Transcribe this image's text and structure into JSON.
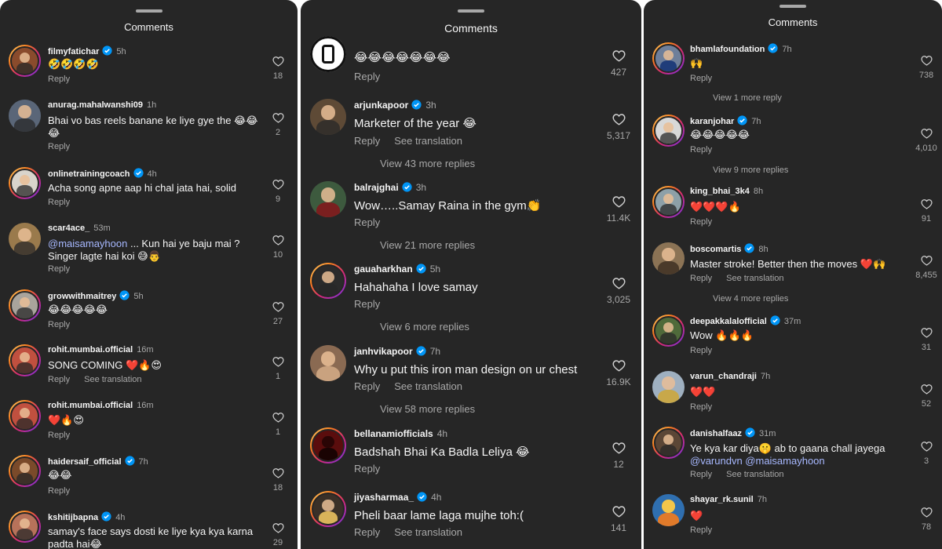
{
  "panels": [
    {
      "title": "Comments",
      "comments": [
        {
          "username": "filmyfatichar",
          "verified": true,
          "time": "5h",
          "text": "🤣🤣🤣🤣",
          "reply": "Reply",
          "likes": "18"
        },
        {
          "username": "anurag.mahalwanshi09",
          "verified": false,
          "time": "1h",
          "text": "Bhai vo bas reels banane ke liye gye the 😂😂😂",
          "reply": "Reply",
          "likes": "2"
        },
        {
          "username": "onlinetrainingcoach",
          "verified": true,
          "time": "4h",
          "text": "Acha song apne aap hi chal jata hai, solid",
          "reply": "Reply",
          "likes": "9"
        },
        {
          "username": "scar4ace_",
          "verified": false,
          "time": "53m",
          "mention": "@maisamayhoon",
          "text": " ... Kun hai ye baju mai ? Singer lagte hai koi 😅👨",
          "reply": "Reply",
          "likes": "10"
        },
        {
          "username": "growwithmaitrey",
          "verified": true,
          "time": "5h",
          "text": "😂😂😂😂😂",
          "reply": "Reply",
          "likes": "27"
        },
        {
          "username": "rohit.mumbai.official",
          "verified": false,
          "time": "16m",
          "text": "SONG COMING ❤️🔥😍",
          "reply": "Reply",
          "translate": "See translation",
          "likes": "1"
        },
        {
          "username": "rohit.mumbai.official",
          "verified": false,
          "time": "16m",
          "text": "❤️🔥😍",
          "reply": "Reply",
          "likes": "1"
        },
        {
          "username": "haidersaif_official",
          "verified": true,
          "time": "7h",
          "text": "😂😂",
          "reply": "Reply",
          "likes": "18"
        },
        {
          "username": "kshitijbapna",
          "verified": true,
          "time": "4h",
          "text": "samay's face says dosti ke liye kya kya karna padta hai😂",
          "reply": "",
          "likes": "29"
        }
      ]
    },
    {
      "title": "Comments",
      "comments": [
        {
          "username": "",
          "verified": false,
          "time": "",
          "text": "😂😂😂😂😂😂😂",
          "reply": "Reply",
          "likes": "427"
        },
        {
          "username": "arjunkapoor",
          "verified": true,
          "time": "3h",
          "text": "Marketer of the year 😂",
          "reply": "Reply",
          "translate": "See translation",
          "likes": "5,317",
          "more": "View 43 more replies"
        },
        {
          "username": "balrajghai",
          "verified": true,
          "time": "3h",
          "text": "Wow…..Samay Raina in the gym👏",
          "reply": "Reply",
          "likes": "11.4K",
          "more": "View 21 more replies"
        },
        {
          "username": "gauaharkhan",
          "verified": true,
          "time": "5h",
          "text": "Hahahaha I love samay",
          "reply": "Reply",
          "likes": "3,025",
          "more": "View 6 more replies"
        },
        {
          "username": "janhvikapoor",
          "verified": true,
          "time": "7h",
          "text": "Why u put this iron man design on ur chest",
          "reply": "Reply",
          "translate": "See translation",
          "likes": "16.9K",
          "more": "View 58 more replies"
        },
        {
          "username": "bellanamiofficials",
          "verified": false,
          "time": "4h",
          "text": "Badshah Bhai Ka Badla Leliya 😂",
          "reply": "Reply",
          "likes": "12"
        },
        {
          "username": "jiyasharmaa_",
          "verified": true,
          "time": "4h",
          "text": "Pheli baar lame laga mujhe toh:(",
          "reply": "Reply",
          "translate": "See translation",
          "likes": "141"
        }
      ]
    },
    {
      "title": "Comments",
      "comments": [
        {
          "username": "bhamlafoundation",
          "verified": true,
          "time": "7h",
          "text": "🙌",
          "reply": "Reply",
          "likes": "738",
          "more": "View 1 more reply"
        },
        {
          "username": "karanjohar",
          "verified": true,
          "time": "7h",
          "text": "😂😂😂😂😂",
          "reply": "Reply",
          "likes": "4,010",
          "more": "View 9 more replies"
        },
        {
          "username": "king_bhai_3k4",
          "verified": false,
          "time": "8h",
          "text": "❤️❤️❤️🔥",
          "reply": "Reply",
          "likes": "91"
        },
        {
          "username": "boscomartis",
          "verified": true,
          "time": "8h",
          "text": "Master stroke! Better then the moves ❤️🙌",
          "reply": "Reply",
          "translate": "See translation",
          "likes": "8,455",
          "more": "View 4 more replies"
        },
        {
          "username": "deepakkalalofficial",
          "verified": true,
          "time": "37m",
          "text": "Wow 🔥🔥🔥",
          "reply": "Reply",
          "likes": "31"
        },
        {
          "username": "varun_chandraji",
          "verified": false,
          "time": "7h",
          "text": "❤️❤️",
          "reply": "Reply",
          "likes": "52"
        },
        {
          "username": "danishalfaaz",
          "verified": true,
          "time": "31m",
          "text": "Ye kya kar diya🤫 ab to gaana chall jayega",
          "mentions2": "@varundvn @maisamayhoon",
          "reply": "Reply",
          "translate": "See translation",
          "likes": "3"
        },
        {
          "username": "shayar_rk.sunil",
          "verified": false,
          "time": "7h",
          "text": "❤️",
          "reply": "Reply",
          "likes": "78"
        }
      ]
    }
  ],
  "colors": {
    "background": "#262626",
    "text": "#f5f5f5",
    "muted": "#a8a8a8",
    "verified": "#0095f6",
    "mention": "#a7b8ff"
  },
  "icons": {
    "like": "heart-outline-icon",
    "verified": "verified-badge-icon"
  }
}
